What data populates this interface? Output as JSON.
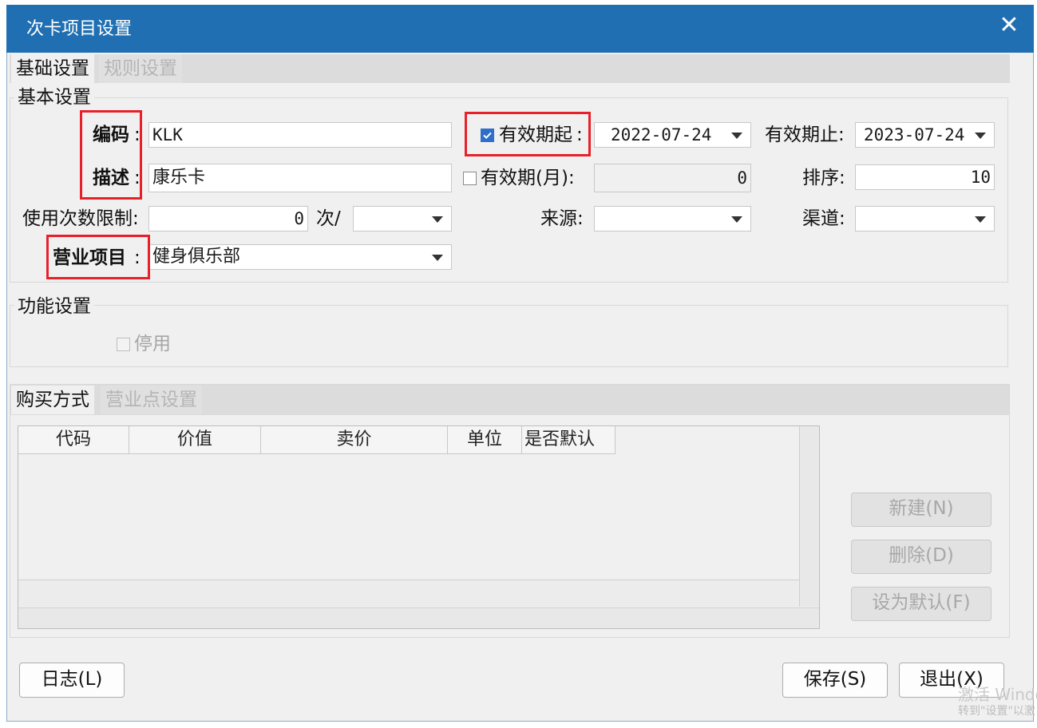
{
  "window": {
    "title": "次卡项目设置",
    "close_label": "✕"
  },
  "tabs": [
    {
      "label": "基础设置"
    },
    {
      "label": "规则设置"
    }
  ],
  "basic": {
    "group_label": "基本设置",
    "code_label": "编码",
    "code_value": "KLK",
    "desc_label": "描述",
    "desc_value": "康乐卡",
    "usage_label": "使用次数限制:",
    "usage_value": "0",
    "usage_unit": "次/",
    "usage_period": "",
    "business_label": "营业项目",
    "business_value": "健身俱乐部",
    "valid_from_label": "有效期起",
    "valid_from_checked": true,
    "valid_from_value": "2022-07-24",
    "valid_to_label": "有效期止:",
    "valid_to_value": "2023-07-24",
    "valid_months_label": "有效期(月):",
    "valid_months_checked": false,
    "valid_months_value": "0",
    "sort_label": "排序:",
    "sort_value": "10",
    "source_label": "来源:",
    "source_value": "",
    "channel_label": "渠道:",
    "channel_value": ""
  },
  "colon": ":",
  "function": {
    "group_label": "功能设置",
    "disable_label": "停用",
    "disable_checked": false
  },
  "purchase_tabs": [
    {
      "label": "购买方式"
    },
    {
      "label": "营业点设置"
    }
  ],
  "purchase_table": {
    "columns": [
      "代码",
      "价值",
      "卖价",
      "单位",
      "是否默认"
    ],
    "rows": []
  },
  "buttons": {
    "new": "新建(N)",
    "delete": "删除(D)",
    "set_default": "设为默认(F)",
    "log": "日志(L)",
    "save": "保存(S)",
    "exit": "退出(X)"
  },
  "watermark": {
    "line1": "激活 Windo",
    "line2": "转到\"设置\"以激"
  },
  "colors": {
    "titlebar": "#1f6fb2",
    "highlight_box": "#e8202a",
    "checkbox_checked": "#2f6ec9"
  }
}
